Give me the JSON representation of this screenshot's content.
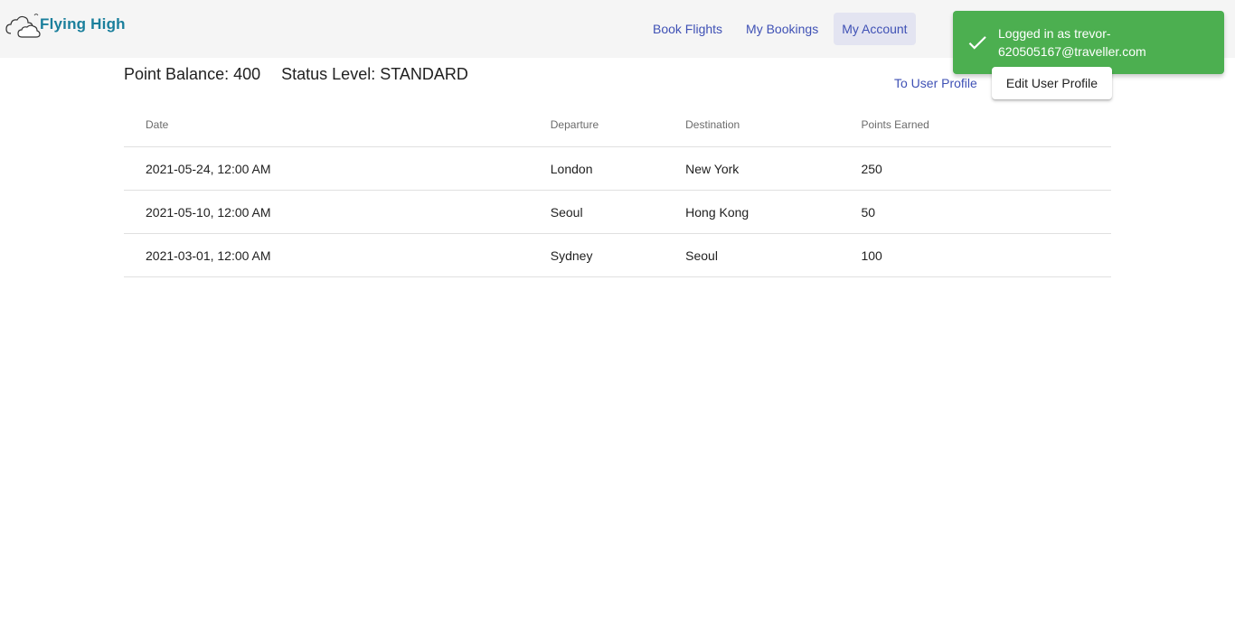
{
  "header": {
    "logo_text": "Flying High",
    "logo_icon": "cloud-icon",
    "nav": {
      "book_flights": "Book Flights",
      "my_bookings": "My Bookings",
      "my_account": "My Account"
    }
  },
  "toast": {
    "icon": "check-icon",
    "message": "Logged in as trevor-620505167@traveller.com",
    "color": "#4caf50"
  },
  "account": {
    "point_balance": "Point Balance: 400",
    "status_level": "Status Level: STANDARD",
    "to_user_profile": "To User Profile",
    "edit_user_profile": "Edit User Profile"
  },
  "table": {
    "headers": [
      "Date",
      "Departure",
      "Destination",
      "Points Earned"
    ],
    "rows": [
      [
        "2021-05-24, 12:00 AM",
        "London",
        "New York",
        "250"
      ],
      [
        "2021-05-10, 12:00 AM",
        "Seoul",
        "Hong Kong",
        "50"
      ],
      [
        "2021-03-01, 12:00 AM",
        "Sydney",
        "Seoul",
        "100"
      ]
    ]
  },
  "colors": {
    "accent": "#3f51b5",
    "topbar": "#f5f5f5",
    "logo": "#1a7f9c"
  }
}
